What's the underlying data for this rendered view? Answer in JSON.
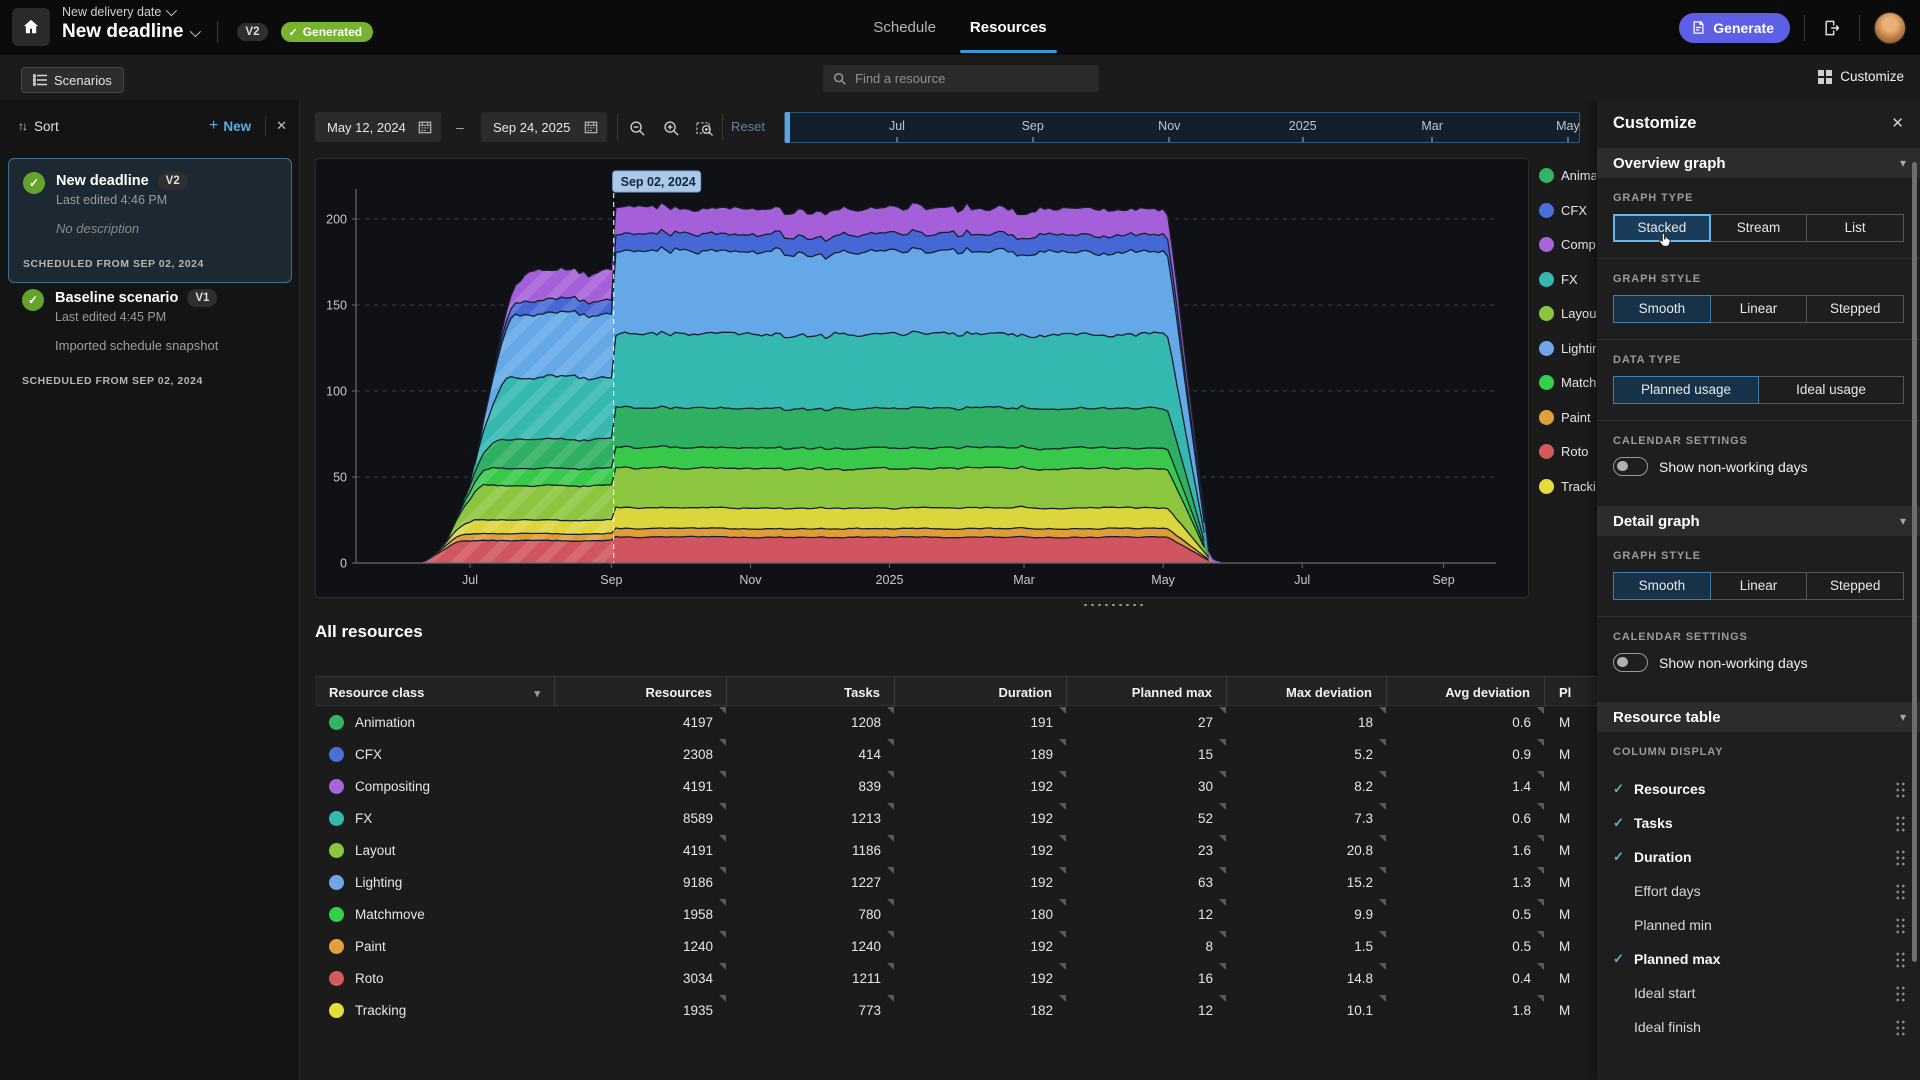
{
  "topbar": {
    "project_label": "New delivery date",
    "scenario_title": "New deadline",
    "version_badge": "V2",
    "status_badge": "Generated",
    "tabs": {
      "0": "Schedule",
      "1": "Resources"
    },
    "generate_label": "Generate"
  },
  "subheader": {
    "scenarios_label": "Scenarios",
    "search_placeholder": "Find a resource",
    "customize_label": "Customize"
  },
  "sidebar": {
    "sort_label": "Sort",
    "new_label": "New",
    "cards": {
      "0": {
        "title": "New deadline",
        "version": "V2",
        "edited": "Last edited 4:46 PM",
        "description": "No description",
        "scheduled": "SCHEDULED FROM SEP 02, 2024",
        "selected": true
      },
      "1": {
        "title": "Baseline scenario",
        "version": "V1",
        "edited": "Last edited 4:45 PM",
        "description": "Imported schedule snapshot",
        "scheduled": "SCHEDULED FROM SEP 02, 2024",
        "selected": false
      }
    }
  },
  "toolbar": {
    "start_date": "May 12, 2024",
    "end_date": "Sep 24, 2025",
    "range_separator": "–",
    "reset_label": "Reset"
  },
  "scrubber": {
    "ticks": [
      {
        "label": "Jul",
        "pos": 0.141
      },
      {
        "label": "Sep",
        "pos": 0.312
      },
      {
        "label": "Nov",
        "pos": 0.484
      },
      {
        "label": "2025",
        "pos": 0.652
      },
      {
        "label": "Mar",
        "pos": 0.815
      },
      {
        "label": "May",
        "pos": 0.986
      }
    ]
  },
  "chart_data": {
    "type": "area",
    "stacked": true,
    "x_domain_labels": [
      "May 12, 2024",
      "Sep 24, 2025"
    ],
    "x_domain_days": 500,
    "x_ticks": [
      {
        "label": "Jul",
        "day": 50
      },
      {
        "label": "Sep",
        "day": 112
      },
      {
        "label": "Nov",
        "day": 173
      },
      {
        "label": "2025",
        "day": 234
      },
      {
        "label": "Mar",
        "day": 293
      },
      {
        "label": "May",
        "day": 354
      },
      {
        "label": "Jul",
        "day": 415
      },
      {
        "label": "Sep",
        "day": 477
      }
    ],
    "y_ticks": [
      0,
      50,
      100,
      150,
      200
    ],
    "ylim": [
      0,
      230
    ],
    "grid": true,
    "marker": {
      "label": "Sep 02, 2024",
      "day": 113
    },
    "data_start_day": 29,
    "phase_change_day": 113,
    "data_end_day": 377,
    "hatched_before_marker": true,
    "series": [
      {
        "name": "Roto",
        "color": "#d05560",
        "value_before": 13,
        "value_after": 15
      },
      {
        "name": "Paint",
        "color": "#df9d37",
        "value_before": 4,
        "value_after": 5
      },
      {
        "name": "Tracking",
        "color": "#ddd53e",
        "value_before": 8,
        "value_after": 12
      },
      {
        "name": "Layout",
        "color": "#8cc63e",
        "value_before": 20,
        "value_after": 23
      },
      {
        "name": "Matchmove",
        "color": "#38c94b",
        "value_before": 10,
        "value_after": 12
      },
      {
        "name": "Animation",
        "color": "#2eaf62",
        "value_before": 17,
        "value_after": 23
      },
      {
        "name": "FX",
        "color": "#35b8b0",
        "value_before": 36,
        "value_after": 43
      },
      {
        "name": "Lighting",
        "color": "#64a8e8",
        "value_before": 37,
        "value_after": 48
      },
      {
        "name": "CFX",
        "color": "#4668d6",
        "value_before": 8,
        "value_after": 10
      },
      {
        "name": "Compositing",
        "color": "#a55fd8",
        "value_before": 17,
        "value_after": 15
      }
    ]
  },
  "legend": {
    "items": [
      {
        "label": "Animation",
        "color": "#31b562"
      },
      {
        "label": "CFX",
        "color": "#4a6fdb"
      },
      {
        "label": "Compositing",
        "color": "#a863dd"
      },
      {
        "label": "FX",
        "color": "#35b8b0"
      },
      {
        "label": "Layout",
        "color": "#8bc63f"
      },
      {
        "label": "Lighting",
        "color": "#6ea6e8"
      },
      {
        "label": "Matchmove",
        "color": "#35d04a"
      },
      {
        "label": "Paint",
        "color": "#e0a13a"
      },
      {
        "label": "Roto",
        "color": "#d65a5a"
      },
      {
        "label": "Tracking",
        "color": "#e3dd3d"
      }
    ]
  },
  "resources_table": {
    "title": "All resources",
    "columns": [
      "Resource class",
      "Resources",
      "Tasks",
      "Duration",
      "Planned max",
      "Max deviation",
      "Avg deviation",
      "Pl"
    ],
    "rows": [
      {
        "class": "Animation",
        "color": "#31b562",
        "values": [
          "4197",
          "1208",
          "191",
          "27",
          "18",
          "0.6",
          "M"
        ]
      },
      {
        "class": "CFX",
        "color": "#4a6fdb",
        "values": [
          "2308",
          "414",
          "189",
          "15",
          "5.2",
          "0.9",
          "M"
        ]
      },
      {
        "class": "Compositing",
        "color": "#a863dd",
        "values": [
          "4191",
          "839",
          "192",
          "30",
          "8.2",
          "1.4",
          "M"
        ]
      },
      {
        "class": "FX",
        "color": "#35b8b0",
        "values": [
          "8589",
          "1213",
          "192",
          "52",
          "7.3",
          "0.6",
          "M"
        ]
      },
      {
        "class": "Layout",
        "color": "#8bc63f",
        "values": [
          "4191",
          "1186",
          "192",
          "23",
          "20.8",
          "1.6",
          "M"
        ]
      },
      {
        "class": "Lighting",
        "color": "#6ea6e8",
        "values": [
          "9186",
          "1227",
          "192",
          "63",
          "15.2",
          "1.3",
          "M"
        ]
      },
      {
        "class": "Matchmove",
        "color": "#35d04a",
        "values": [
          "1958",
          "780",
          "180",
          "12",
          "9.9",
          "0.5",
          "M"
        ]
      },
      {
        "class": "Paint",
        "color": "#e0a13a",
        "values": [
          "1240",
          "1240",
          "192",
          "8",
          "1.5",
          "0.5",
          "M"
        ]
      },
      {
        "class": "Roto",
        "color": "#d65a5a",
        "values": [
          "3034",
          "1211",
          "192",
          "16",
          "14.8",
          "0.4",
          "M"
        ]
      },
      {
        "class": "Tracking",
        "color": "#e3dd3d",
        "values": [
          "1935",
          "773",
          "182",
          "12",
          "10.1",
          "1.8",
          "M"
        ]
      }
    ]
  },
  "customize": {
    "title": "Customize",
    "overview": {
      "title": "Overview graph",
      "graph_type_label": "GRAPH TYPE",
      "graph_type": {
        "options": [
          "Stacked",
          "Stream",
          "List"
        ],
        "selected": 0,
        "focused": 0,
        "cursor": 0
      },
      "graph_style_label": "GRAPH STYLE",
      "graph_style": {
        "options": [
          "Smooth",
          "Linear",
          "Stepped"
        ],
        "selected": 0
      },
      "data_type_label": "DATA TYPE",
      "data_type": {
        "options": [
          "Planned usage",
          "Ideal usage"
        ],
        "selected": 0
      },
      "calendar_label": "CALENDAR SETTINGS",
      "toggle_label": "Show non-working days",
      "toggle_on": false
    },
    "detail": {
      "title": "Detail graph",
      "graph_style_label": "GRAPH STYLE",
      "graph_style": {
        "options": [
          "Smooth",
          "Linear",
          "Stepped"
        ],
        "selected": 0
      },
      "calendar_label": "CALENDAR SETTINGS",
      "toggle_label": "Show non-working days",
      "toggle_on": false
    },
    "table": {
      "title": "Resource table",
      "column_display_label": "COLUMN DISPLAY",
      "columns": [
        {
          "label": "Resources",
          "checked": true
        },
        {
          "label": "Tasks",
          "checked": true
        },
        {
          "label": "Duration",
          "checked": true
        },
        {
          "label": "Effort days",
          "checked": false
        },
        {
          "label": "Planned min",
          "checked": false
        },
        {
          "label": "Planned max",
          "checked": true
        },
        {
          "label": "Ideal start",
          "checked": false
        },
        {
          "label": "Ideal finish",
          "checked": false
        }
      ]
    }
  }
}
